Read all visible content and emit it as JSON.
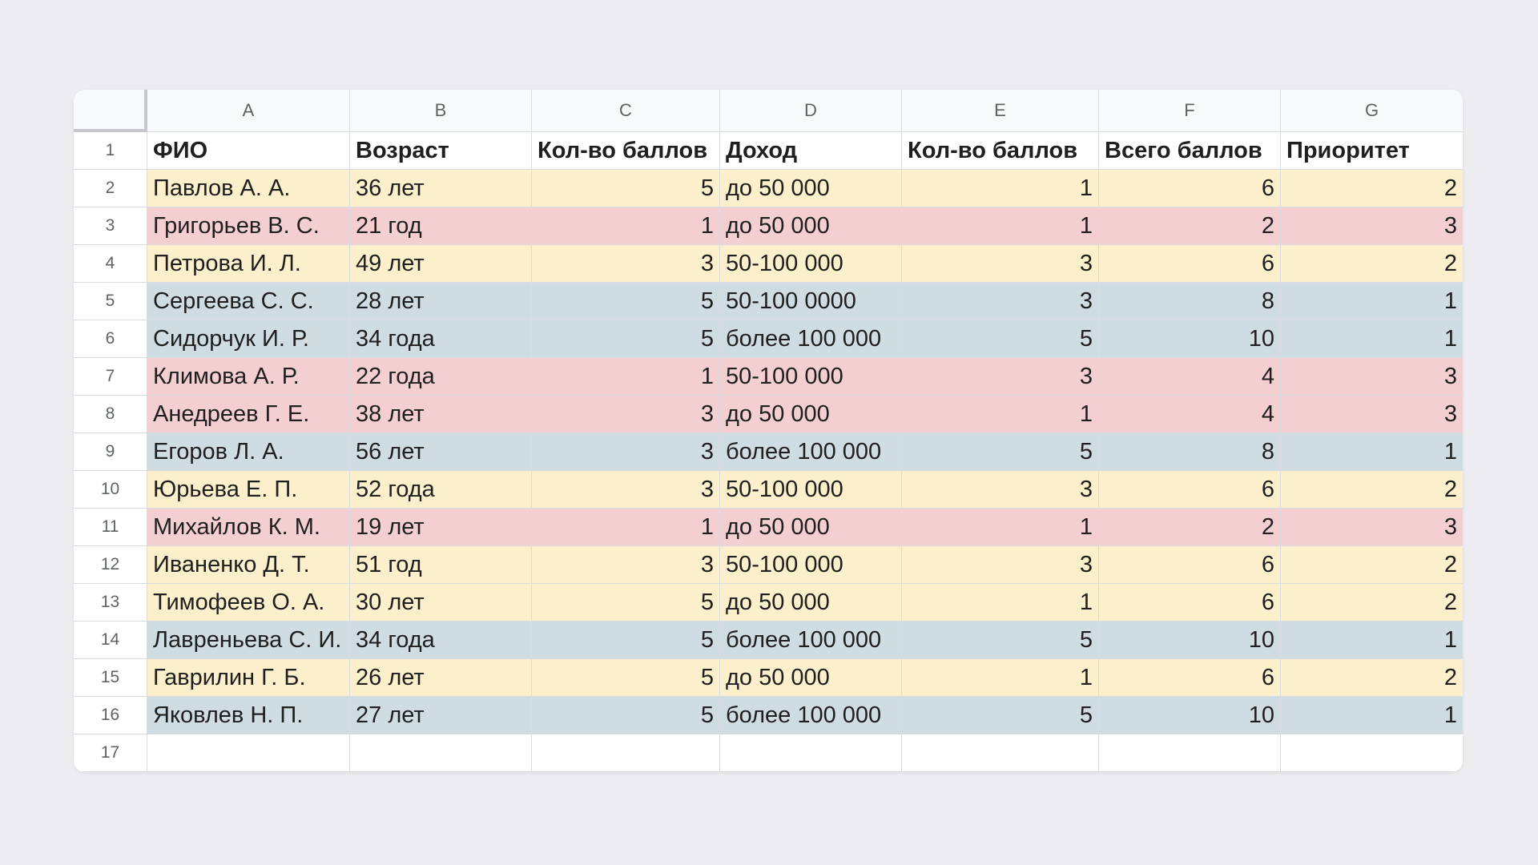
{
  "columns": [
    "A",
    "B",
    "C",
    "D",
    "E",
    "F",
    "G"
  ],
  "header_row_number": "1",
  "headers": [
    "ФИО",
    "Возраст",
    "Кол-во баллов",
    "Доход",
    "Кол-во баллов",
    "Всего баллов",
    "Приоритет"
  ],
  "colors": {
    "priority_1": "#cfdde3",
    "priority_2": "#fcefcb",
    "priority_3": "#f3cfd1"
  },
  "rows": [
    {
      "row_number": "2",
      "cells": [
        "Павлов А. А.",
        "36 лет",
        "5",
        "до 50 000",
        "1",
        "6",
        "2"
      ],
      "color": "#fcefcb"
    },
    {
      "row_number": "3",
      "cells": [
        "Григорьев В. С.",
        "21 год",
        "1",
        "до 50 000",
        "1",
        "2",
        "3"
      ],
      "color": "#f3cfd1"
    },
    {
      "row_number": "4",
      "cells": [
        "Петрова И. Л.",
        "49 лет",
        "3",
        "50-100 000",
        "3",
        "6",
        "2"
      ],
      "color": "#fcefcb"
    },
    {
      "row_number": "5",
      "cells": [
        "Сергеева С. С.",
        "28 лет",
        "5",
        "50-100 0000",
        "3",
        "8",
        "1"
      ],
      "color": "#cfdde3"
    },
    {
      "row_number": "6",
      "cells": [
        "Сидорчук И. Р.",
        "34 года",
        "5",
        "более 100 000",
        "5",
        "10",
        "1"
      ],
      "color": "#cfdde3"
    },
    {
      "row_number": "7",
      "cells": [
        "Климова А. Р.",
        "22 года",
        "1",
        "50-100 000",
        "3",
        "4",
        "3"
      ],
      "color": "#f3cfd1"
    },
    {
      "row_number": "8",
      "cells": [
        "Анедреев Г. Е.",
        "38 лет",
        "3",
        "до 50 000",
        "1",
        "4",
        "3"
      ],
      "color": "#f3cfd1"
    },
    {
      "row_number": "9",
      "cells": [
        "Егоров Л. А.",
        "56 лет",
        "3",
        "более 100 000",
        "5",
        "8",
        "1"
      ],
      "color": "#cfdde3"
    },
    {
      "row_number": "10",
      "cells": [
        "Юрьева Е. П.",
        "52 года",
        "3",
        "50-100 000",
        "3",
        "6",
        "2"
      ],
      "color": "#fcefcb"
    },
    {
      "row_number": "11",
      "cells": [
        "Михайлов К. М.",
        "19 лет",
        "1",
        "до 50 000",
        "1",
        "2",
        "3"
      ],
      "color": "#f3cfd1"
    },
    {
      "row_number": "12",
      "cells": [
        "Иваненко Д. Т.",
        "51 год",
        "3",
        "50-100 000",
        "3",
        "6",
        "2"
      ],
      "color": "#fcefcb"
    },
    {
      "row_number": "13",
      "cells": [
        "Тимофеев О. А.",
        "30 лет",
        "5",
        "до 50 000",
        "1",
        "6",
        "2"
      ],
      "color": "#fcefcb"
    },
    {
      "row_number": "14",
      "cells": [
        "Лавреньева С. И.",
        "34 года",
        "5",
        "более 100 000",
        "5",
        "10",
        "1"
      ],
      "color": "#cfdde3"
    },
    {
      "row_number": "15",
      "cells": [
        "Гаврилин Г. Б.",
        "26 лет",
        "5",
        "до 50 000",
        "1",
        "6",
        "2"
      ],
      "color": "#fcefcb"
    },
    {
      "row_number": "16",
      "cells": [
        "Яковлев Н. П.",
        "27 лет",
        "5",
        "более 100 000",
        "5",
        "10",
        "1"
      ],
      "color": "#cfdde3"
    }
  ],
  "empty_row_number": "17"
}
